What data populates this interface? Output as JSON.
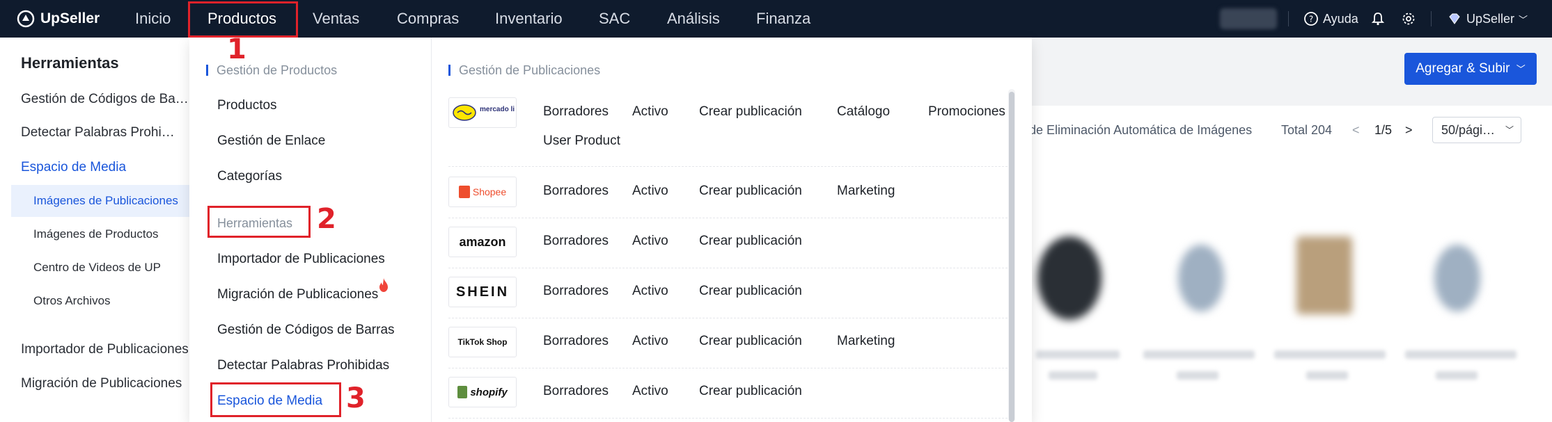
{
  "app": {
    "name": "UpSeller"
  },
  "nav": {
    "items": [
      "Inicio",
      "Productos",
      "Ventas",
      "Compras",
      "Inventario",
      "SAC",
      "Análisis",
      "Finanza"
    ],
    "active": "Productos",
    "help": "Ayuda",
    "account": "UpSeller"
  },
  "sidebar": {
    "title": "Herramientas",
    "items": [
      "Gestión de Códigos de Ba…",
      "Detectar Palabras Prohi…",
      "Espacio de Media"
    ],
    "subitems": [
      "Imágenes de Publicaciones",
      "Imágenes de Productos",
      "Centro de Videos de UP",
      "Otros Archivos"
    ],
    "items_bottom": [
      "Importador de Publicaciones",
      "Migración de Publicaciones"
    ]
  },
  "main": {
    "add_button": "Agregar & Subir",
    "auto_delete_text": "de Eliminación Automática de Imágenes",
    "total": "Total 204",
    "page": "1/5",
    "page_size": "50/pági…"
  },
  "dropdown": {
    "left_section": "Gestión de Productos",
    "left_items": [
      "Productos",
      "Gestión de Enlace",
      "Categorías"
    ],
    "tools_section": "Herramientas",
    "tool_items": [
      "Importador de Publicaciones",
      "Migración de Publicaciones",
      "Gestión de Códigos de Barras",
      "Detectar Palabras Prohibidas",
      "Espacio de Media"
    ],
    "right_section": "Gestión de Publicaciones",
    "platforms": [
      {
        "logo": "mercado libre",
        "links": [
          "Borradores",
          "Activo",
          "Crear publicación",
          "Catálogo",
          "Promociones",
          "User Product"
        ]
      },
      {
        "logo": "Shopee",
        "links": [
          "Borradores",
          "Activo",
          "Crear publicación",
          "Marketing"
        ]
      },
      {
        "logo": "amazon",
        "links": [
          "Borradores",
          "Activo",
          "Crear publicación"
        ]
      },
      {
        "logo": "SHEIN",
        "links": [
          "Borradores",
          "Activo",
          "Crear publicación"
        ]
      },
      {
        "logo": "TikTok Shop",
        "links": [
          "Borradores",
          "Activo",
          "Crear publicación",
          "Marketing"
        ]
      },
      {
        "logo": "shopify",
        "links": [
          "Borradores",
          "Activo",
          "Crear publicación"
        ]
      }
    ]
  },
  "annotations": [
    "1",
    "2",
    "3"
  ],
  "colors": {
    "accent": "#1a56db",
    "nav_bg": "#0f1b2d",
    "annotation_red": "#e0222a"
  }
}
